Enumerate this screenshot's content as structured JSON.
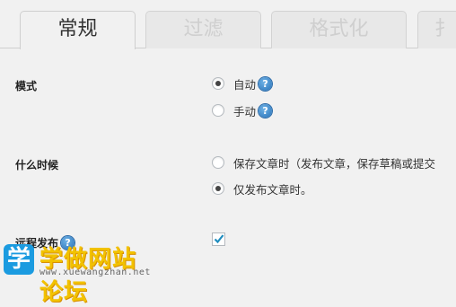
{
  "tabs": [
    "常规",
    "过滤",
    "格式化",
    "扌"
  ],
  "settings": {
    "mode": {
      "label": "模式",
      "options": [
        {
          "label": "自动",
          "checked": true,
          "help_icon": "question-icon"
        },
        {
          "label": "手动",
          "checked": false,
          "help_icon": "question-icon"
        }
      ]
    },
    "when": {
      "label": "什么时候",
      "options": [
        {
          "label": "保存文章时（发布文章，保存草稿或提交",
          "checked": false
        },
        {
          "label": "仅发布文章时。",
          "checked": true
        }
      ]
    },
    "remote": {
      "label": "远程发布",
      "help_icon": "question-icon",
      "checked": true
    }
  },
  "help_glyph": "?",
  "watermark": {
    "logo_char": "学",
    "text": "学做网站论坛",
    "url": "www.xuewangzhan.net"
  },
  "colors": {
    "help_icon": "#2872b8",
    "watermark_text": "#f2c200",
    "watermark_logo": "#1b9be0"
  }
}
